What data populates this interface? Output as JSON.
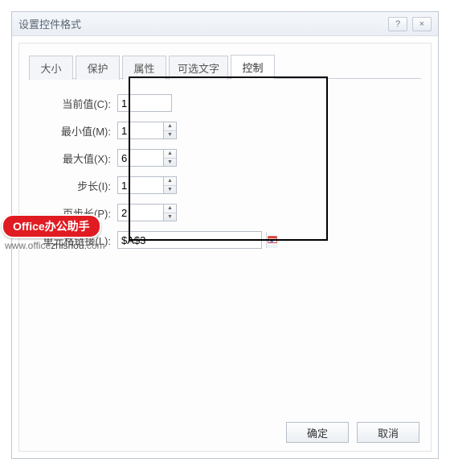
{
  "dialog": {
    "title": "设置控件格式",
    "help_label": "?",
    "close_label": "×"
  },
  "tabs": {
    "t0": "大小",
    "t1": "保护",
    "t2": "属性",
    "t3": "可选文字",
    "t4": "控制"
  },
  "fields": {
    "current": {
      "label": "当前值(C):",
      "value": "1"
    },
    "min": {
      "label": "最小值(M):",
      "value": "1"
    },
    "max": {
      "label": "最大值(X):",
      "value": "6"
    },
    "step": {
      "label": "步长(I):",
      "value": "1"
    },
    "page": {
      "label": "页步长(P):",
      "value": "2"
    },
    "link": {
      "label": "单元格链接(L):",
      "value": "$A$3"
    }
  },
  "footer": {
    "ok": "确定",
    "cancel": "取消"
  },
  "watermark": {
    "brand_en": "Office",
    "brand_cn": "办公助手",
    "url1": "www.office",
    "url2": "zhishou.",
    "url3": "com"
  }
}
